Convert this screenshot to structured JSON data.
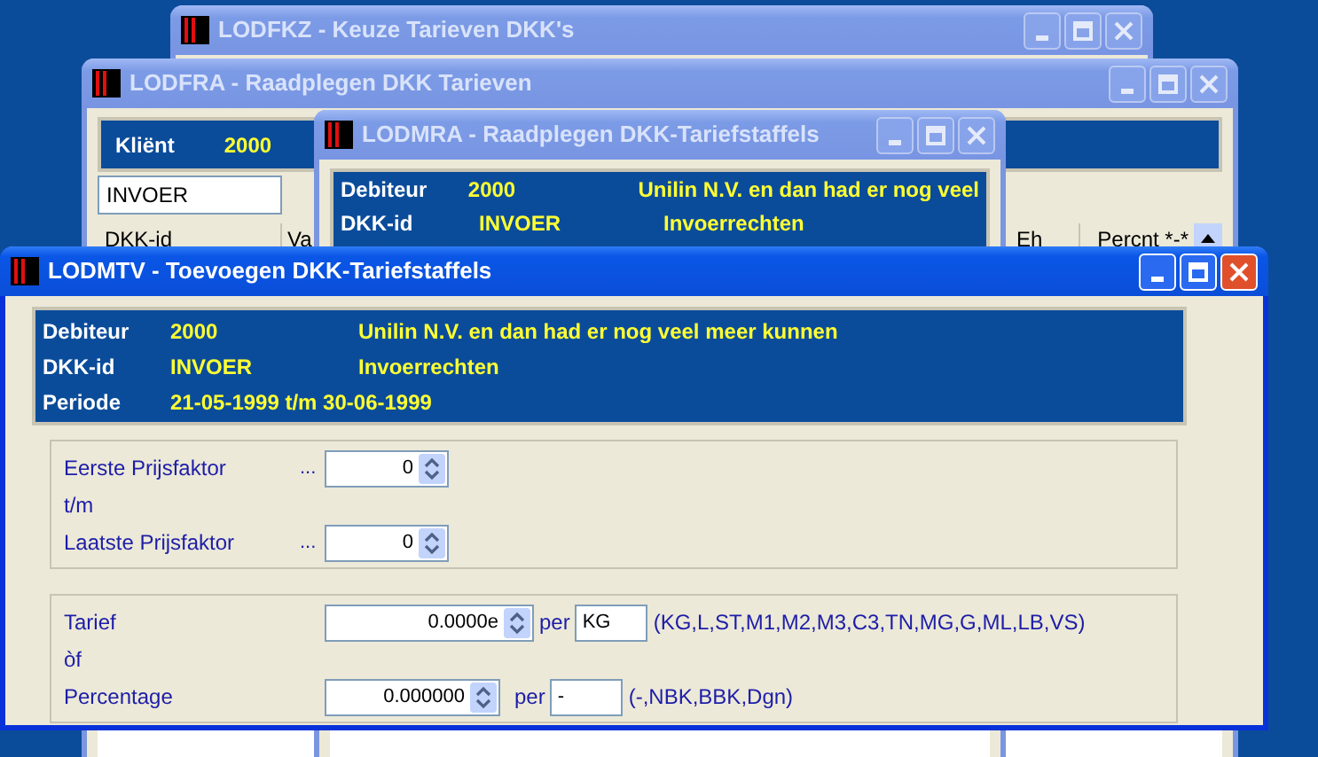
{
  "windows": [
    {
      "title": "LODFKZ - Keuze Tarieven DKK's",
      "active": false
    },
    {
      "title": "LODFRA - Raadplegen DKK Tarieven",
      "active": false
    },
    {
      "title": "LODMRA - Raadplegen DKK-Tariefstaffels",
      "active": false
    },
    {
      "title": "LODMTV - Toevoegen DKK-Tariefstaffels",
      "active": true
    }
  ],
  "lodfra": {
    "client_label": "Kliënt",
    "client_value": "2000",
    "filter_value": "INVOER",
    "columns": [
      "DKK-id",
      "Va",
      "Eh",
      "Percnt *-*"
    ]
  },
  "lodmra": {
    "rows": [
      {
        "label": "Debiteur",
        "value": "2000",
        "description": "Unilin N.V. en dan had er nog veel"
      },
      {
        "label": "DKK-id",
        "value": "INVOER",
        "description": "Invoerrechten"
      }
    ]
  },
  "lodmtv": {
    "info": [
      {
        "label": "Debiteur",
        "value": "2000",
        "description": "Unilin N.V. en dan had er nog veel meer kunnen"
      },
      {
        "label": "DKK-id",
        "value": "INVOER",
        "description": "Invoerrechten"
      },
      {
        "label": "Periode",
        "value": "21-05-1999 t/m 30-06-1999"
      }
    ],
    "range": {
      "first_label": "Eerste  Prijsfaktor",
      "first_dots": "...",
      "first_value": "0",
      "between": "t/m",
      "last_label": "Laatste Prijsfaktor",
      "last_dots": "...",
      "last_value": "0"
    },
    "rate": {
      "tariff_label": "Tarief",
      "tariff_value": "0.0000e",
      "tariff_per": "per",
      "tariff_unit": "KG",
      "tariff_options": "(KG,L,ST,M1,M2,M3,C3,TN,MG,G,ML,LB,VS)",
      "or_label": "òf",
      "percentage_label": "Percentage",
      "percentage_value": "0.000000",
      "percentage_per": "per",
      "percentage_unit": "-",
      "percentage_options": "(-,NBK,BBK,Dgn)"
    }
  }
}
